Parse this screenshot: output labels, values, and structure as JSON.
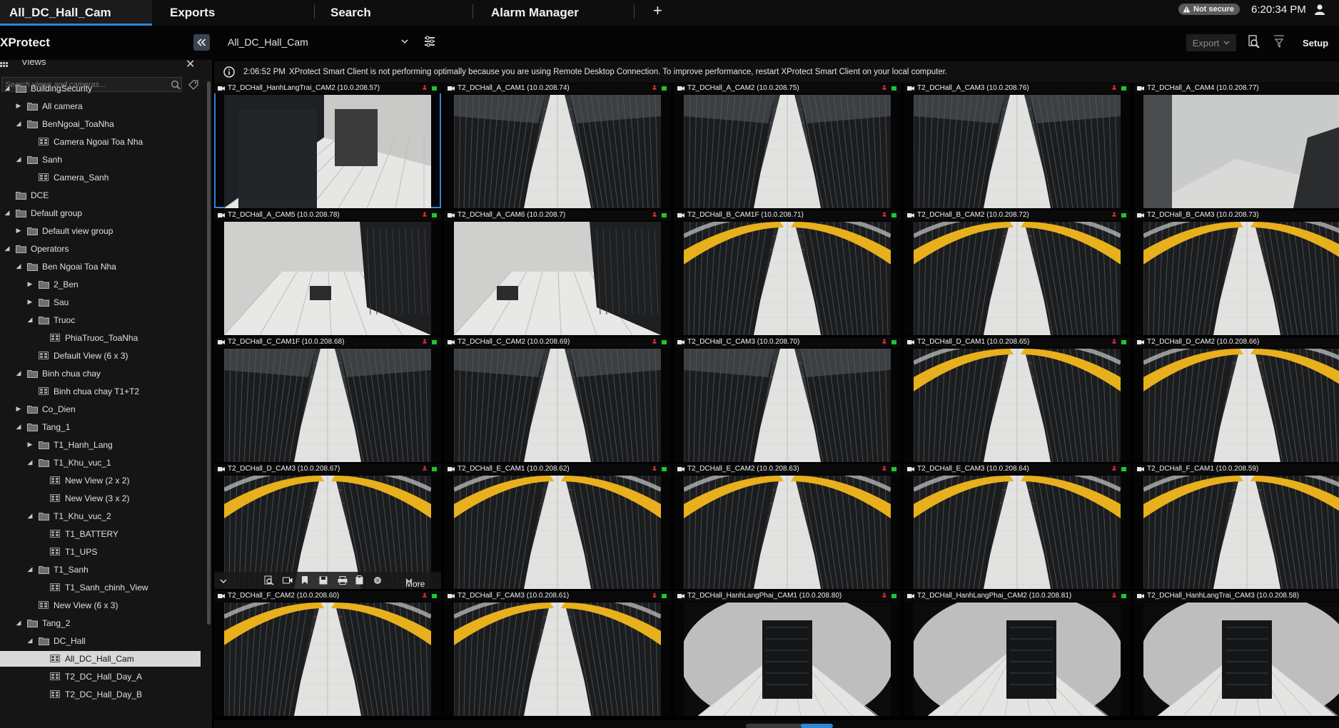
{
  "tabs": [
    {
      "label": "All_DC_Hall_Cam",
      "active": true
    },
    {
      "label": "Exports",
      "active": false
    },
    {
      "label": "Search",
      "active": false
    },
    {
      "label": "Alarm Manager",
      "active": false
    }
  ],
  "status": {
    "security_badge": "Not secure",
    "time": "6:20:34 PM"
  },
  "toolbar": {
    "brand": "XProtect",
    "view_name": "All_DC_Hall_Cam",
    "export_label": "Export",
    "setup_label": "Setup"
  },
  "sidebar": {
    "title": "Views",
    "search_placeholder": "Search views and cameras...",
    "tree": [
      {
        "label": "BuildingSecurity",
        "level": 0,
        "exp": "open",
        "icon": "folder"
      },
      {
        "label": "All camera",
        "level": 1,
        "exp": "closed",
        "icon": "folder"
      },
      {
        "label": "BenNgoai_ToaNha",
        "level": 1,
        "exp": "open",
        "icon": "folder"
      },
      {
        "label": "Camera Ngoai Toa Nha",
        "level": 2,
        "exp": "none",
        "icon": "view"
      },
      {
        "label": "Sanh",
        "level": 1,
        "exp": "open",
        "icon": "folder"
      },
      {
        "label": "Camera_Sanh",
        "level": 2,
        "exp": "none",
        "icon": "view"
      },
      {
        "label": "DCE",
        "level": 0,
        "exp": "none",
        "icon": "folder"
      },
      {
        "label": "Default group",
        "level": 0,
        "exp": "open",
        "icon": "folder"
      },
      {
        "label": "Default view group",
        "level": 1,
        "exp": "closed",
        "icon": "folder"
      },
      {
        "label": "Operators",
        "level": 0,
        "exp": "open",
        "icon": "folder"
      },
      {
        "label": "Ben Ngoai Toa Nha",
        "level": 1,
        "exp": "open",
        "icon": "folder"
      },
      {
        "label": "2_Ben",
        "level": 2,
        "exp": "closed",
        "icon": "folder"
      },
      {
        "label": "Sau",
        "level": 2,
        "exp": "closed",
        "icon": "folder"
      },
      {
        "label": "Truoc",
        "level": 2,
        "exp": "open",
        "icon": "folder"
      },
      {
        "label": "PhiaTruoc_ToaNha",
        "level": 3,
        "exp": "none",
        "icon": "view"
      },
      {
        "label": "Default View (6 x 3)",
        "level": 2,
        "exp": "none",
        "icon": "view"
      },
      {
        "label": "Binh chua chay",
        "level": 1,
        "exp": "open",
        "icon": "folder"
      },
      {
        "label": "Binh chua chay  T1+T2",
        "level": 2,
        "exp": "none",
        "icon": "view"
      },
      {
        "label": "Co_Dien",
        "level": 1,
        "exp": "closed",
        "icon": "folder"
      },
      {
        "label": "Tang_1",
        "level": 1,
        "exp": "open",
        "icon": "folder"
      },
      {
        "label": "T1_Hanh_Lang",
        "level": 2,
        "exp": "closed",
        "icon": "folder"
      },
      {
        "label": "T1_Khu_vuc_1",
        "level": 2,
        "exp": "open",
        "icon": "folder"
      },
      {
        "label": "New View (2 x 2)",
        "level": 3,
        "exp": "none",
        "icon": "view"
      },
      {
        "label": "New View (3 x 2)",
        "level": 3,
        "exp": "none",
        "icon": "view"
      },
      {
        "label": "T1_Khu_vuc_2",
        "level": 2,
        "exp": "open",
        "icon": "folder"
      },
      {
        "label": "T1_BATTERY",
        "level": 3,
        "exp": "none",
        "icon": "view"
      },
      {
        "label": "T1_UPS",
        "level": 3,
        "exp": "none",
        "icon": "view"
      },
      {
        "label": "T1_Sanh",
        "level": 2,
        "exp": "open",
        "icon": "folder"
      },
      {
        "label": "T1_Sanh_chinh_View",
        "level": 3,
        "exp": "none",
        "icon": "view"
      },
      {
        "label": "New View (6 x 3)",
        "level": 2,
        "exp": "none",
        "icon": "view"
      },
      {
        "label": "Tang_2",
        "level": 1,
        "exp": "open",
        "icon": "folder"
      },
      {
        "label": "DC_Hall",
        "level": 2,
        "exp": "open",
        "icon": "folder"
      },
      {
        "label": "All_DC_Hall_Cam",
        "level": 3,
        "exp": "none",
        "icon": "view",
        "selected": true
      },
      {
        "label": "T2_DC_Hall_Day_A",
        "level": 3,
        "exp": "none",
        "icon": "view"
      },
      {
        "label": "T2_DC_Hall_Day_B",
        "level": 3,
        "exp": "none",
        "icon": "view"
      }
    ]
  },
  "info": {
    "time": "2:06:52 PM",
    "message": "XProtect Smart Client is not performing optimally because you are using Remote Desktop Connection. To improve performance, restart XProtect Smart Client on your local computer."
  },
  "cameras": [
    {
      "title": "T2_DCHall_HanhLangTrai_CAM2 (10.0.208.57)",
      "scene": "corridor",
      "selected": true
    },
    {
      "title": "T2_DCHall_A_CAM1 (10.0.208.74)",
      "scene": "aisle-dark"
    },
    {
      "title": "T2_DCHall_A_CAM2 (10.0.208.75)",
      "scene": "aisle-dark"
    },
    {
      "title": "T2_DCHall_A_CAM3 (10.0.208.76)",
      "scene": "aisle-dark"
    },
    {
      "title": "T2_DCHall_A_CAM4 (10.0.208.77)",
      "scene": "wall"
    },
    {
      "title": "T2_DCHall_A_CAM5 (10.0.208.78)",
      "scene": "room"
    },
    {
      "title": "T2_DCHall_A_CAM6 (10.0.208.7)",
      "scene": "room"
    },
    {
      "title": "T2_DCHall_B_CAM1F (10.0.208.71)",
      "scene": "aisle-yellow"
    },
    {
      "title": "T2_DCHall_B_CAM2 (10.0.208.72)",
      "scene": "aisle-yellow"
    },
    {
      "title": "T2_DCHall_B_CAM3 (10.0.208.73)",
      "scene": "aisle-yellow"
    },
    {
      "title": "T2_DCHall_C_CAM1F (10.0.208.68)",
      "scene": "aisle-dark"
    },
    {
      "title": "T2_DCHall_C_CAM2 (10.0.208.69)",
      "scene": "aisle-dark"
    },
    {
      "title": "T2_DCHall_C_CAM3 (10.0.208.70)",
      "scene": "aisle-dark"
    },
    {
      "title": "T2_DCHall_D_CAM1 (10.0.208.65)",
      "scene": "aisle-yellow"
    },
    {
      "title": "T2_DCHall_D_CAM2 (10.0.208.66)",
      "scene": "aisle-yellow"
    },
    {
      "title": "T2_DCHall_D_CAM3 (10.0.208.67)",
      "scene": "aisle-yellow",
      "toolbar": true
    },
    {
      "title": "T2_DCHall_E_CAM1 (10.0.208.62)",
      "scene": "aisle-yellow"
    },
    {
      "title": "T2_DCHall_E_CAM2 (10.0.208.63)",
      "scene": "aisle-yellow"
    },
    {
      "title": "T2_DCHall_E_CAM3 (10.0.208.64)",
      "scene": "aisle-yellow"
    },
    {
      "title": "T2_DCHall_F_CAM1 (10.0.208.59)",
      "scene": "aisle-yellow"
    },
    {
      "title": "T2_DCHall_F_CAM2 (10.0.208.60)",
      "scene": "aisle-yellow"
    },
    {
      "title": "T2_DCHall_F_CAM3 (10.0.208.61)",
      "scene": "aisle-yellow"
    },
    {
      "title": "T2_DCHall_HanhLangPhai_CAM1 (10.0.208.80)",
      "scene": "fisheye"
    },
    {
      "title": "T2_DCHall_HanhLangPhai_CAM2 (10.0.208.81)",
      "scene": "fisheye"
    },
    {
      "title": "T2_DCHall_HanhLangTrai_CAM3 (10.0.208.58)",
      "scene": "fisheye"
    }
  ],
  "camera_toolbar": {
    "more_label": "More"
  },
  "colors": {
    "accent": "#2e86d6",
    "live": "#1fc431",
    "recording": "#e0322f"
  }
}
